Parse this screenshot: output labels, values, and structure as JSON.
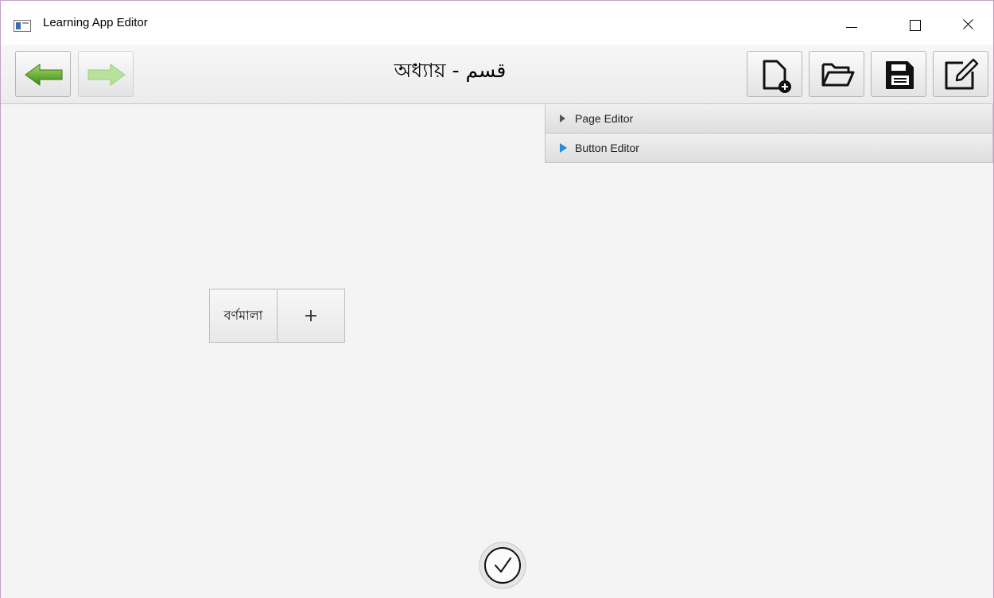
{
  "window": {
    "title": "Learning App Editor"
  },
  "toolbar": {
    "title": "অধ্যায় - قسم",
    "buttons": [
      {
        "name": "back",
        "icon": "arrow-left-icon",
        "enabled": true
      },
      {
        "name": "forward",
        "icon": "arrow-right-icon",
        "enabled": false
      },
      {
        "name": "new",
        "icon": "new-file-icon"
      },
      {
        "name": "open",
        "icon": "folder-open-icon"
      },
      {
        "name": "save",
        "icon": "floppy-disk-icon"
      },
      {
        "name": "edit",
        "icon": "edit-icon"
      }
    ]
  },
  "panels": {
    "items": [
      {
        "label": "Page Editor",
        "active": false
      },
      {
        "label": "Button Editor",
        "active": true
      }
    ]
  },
  "canvas": {
    "word_button": "বর্ণমালা",
    "add_button": "+"
  },
  "colors": {
    "accent_arrow": "#2a8ad4",
    "back_arrow": "#5aa61c",
    "forward_arrow_disabled": "#a8d98a"
  }
}
